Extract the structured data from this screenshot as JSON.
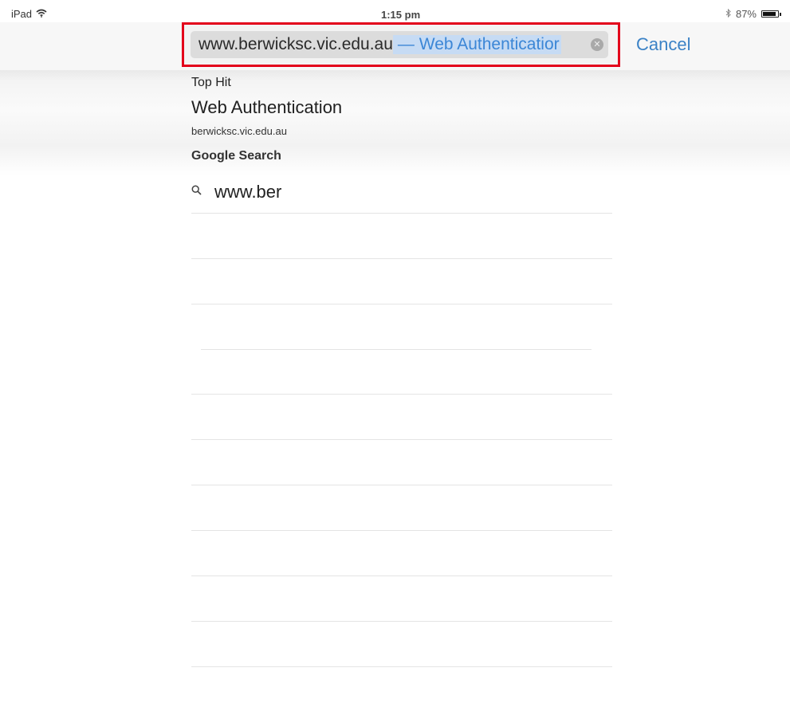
{
  "status_bar": {
    "device": "iPad",
    "time": "1:15 pm",
    "battery_percent": "87%",
    "battery_level": 0.87
  },
  "address_bar": {
    "url": "www.berwicksc.vic.edu.au",
    "suggestion": "— Web Authenticatior",
    "highlight_color": "#e3001b"
  },
  "cancel_label": "Cancel",
  "suggestions": {
    "top_hit_header": "Top Hit",
    "top_hit_title": "Web Authentication",
    "top_hit_url": "berwicksc.vic.edu.au",
    "google_header": "Google Search",
    "google_query": "www.ber"
  },
  "colors": {
    "accent": "#3b82c6"
  }
}
